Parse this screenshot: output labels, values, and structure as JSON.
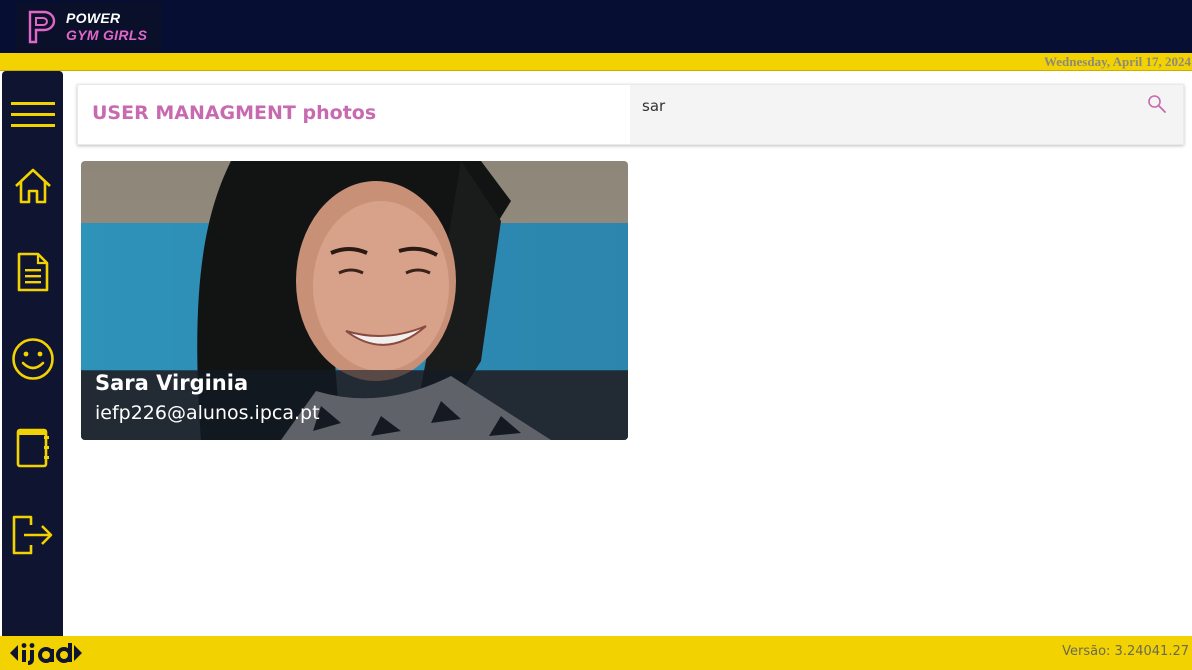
{
  "header": {
    "brand_line1": "POWER",
    "brand_line2": "GYM GIRLS",
    "date": "Wednesday, April 17, 2024"
  },
  "sidebar": {
    "items": [
      {
        "name": "menu",
        "icon": "hamburger-icon"
      },
      {
        "name": "home",
        "icon": "home-icon"
      },
      {
        "name": "documents",
        "icon": "document-icon"
      },
      {
        "name": "users",
        "icon": "smiley-icon"
      },
      {
        "name": "notebook",
        "icon": "notebook-icon"
      },
      {
        "name": "logout",
        "icon": "logout-icon"
      }
    ]
  },
  "main": {
    "title": "USER MANAGMENT photos",
    "search": {
      "value": "sar",
      "placeholder": ""
    }
  },
  "cards": [
    {
      "name": "Sara Virginia",
      "email": "iefp226@alunos.ipca.pt"
    }
  ],
  "footer": {
    "version": "Versão: 3.24041.27",
    "logo": "iad-logo"
  },
  "colors": {
    "topbar": "#060e33",
    "accent_yellow": "#f2d200",
    "sidebar": "#0f1430",
    "title_pink": "#c86ab0",
    "icon_yellow": "#f2d200"
  }
}
